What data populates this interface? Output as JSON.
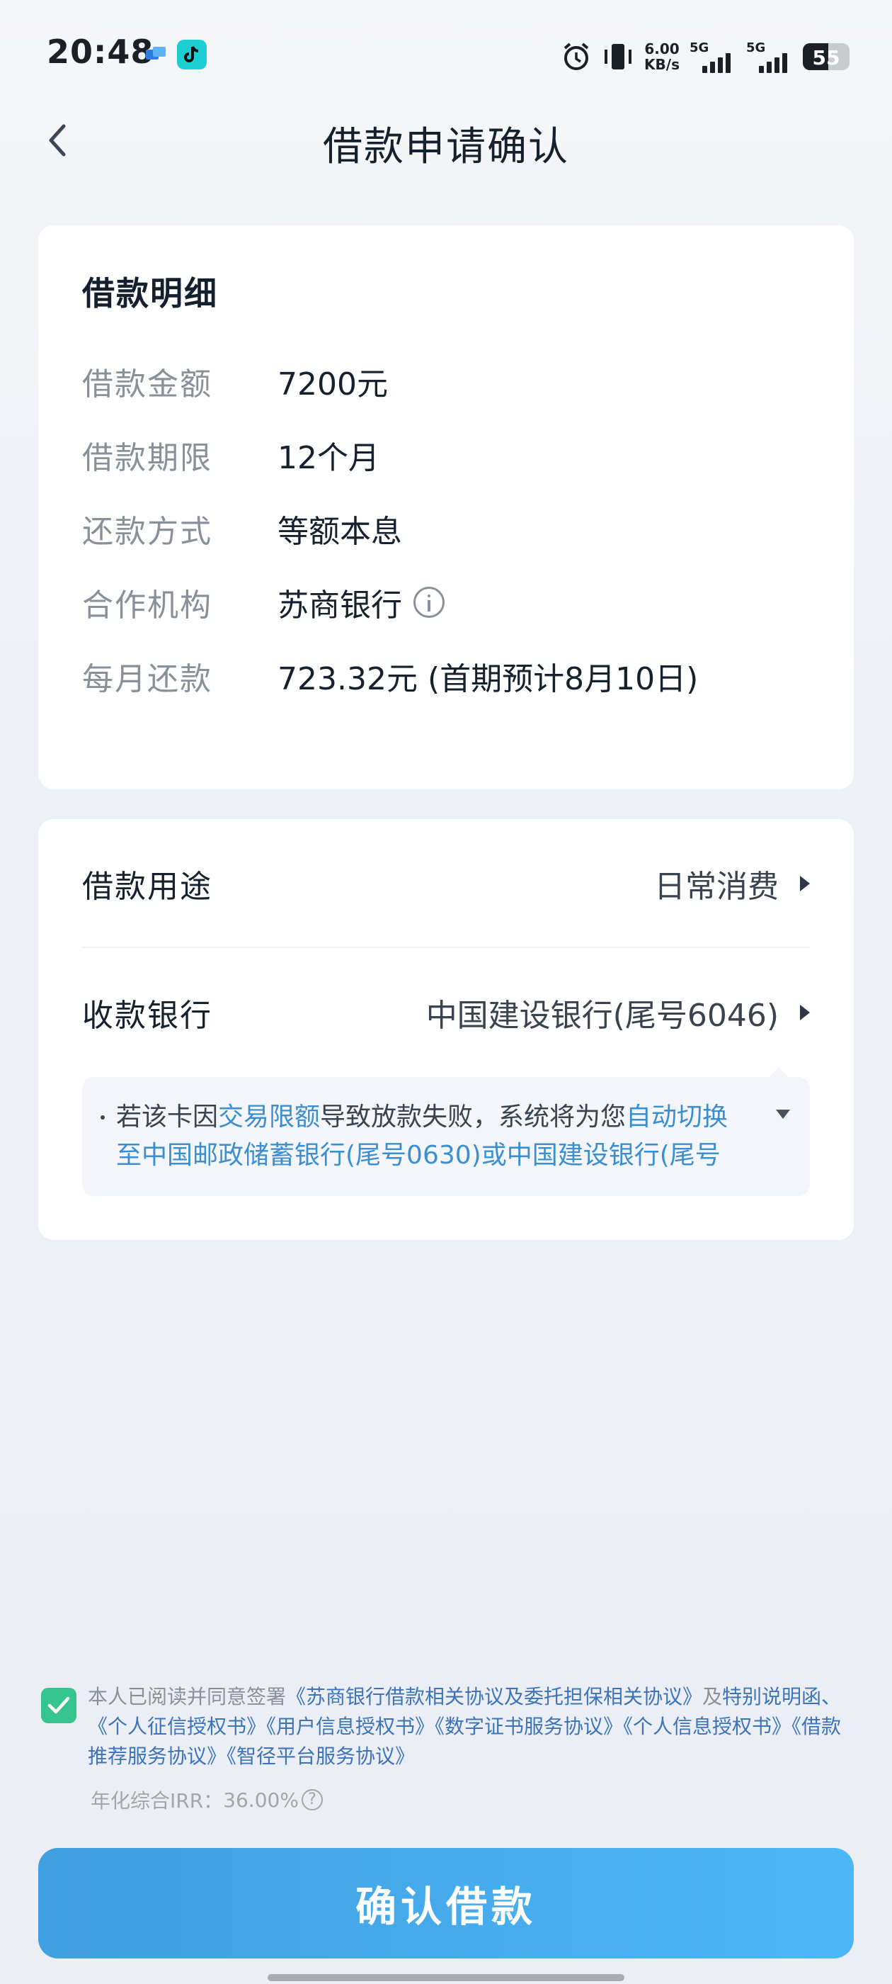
{
  "status_bar": {
    "time": "20:48",
    "speed_value": "6.00",
    "speed_unit": "KB/s",
    "network1": "5G",
    "network2": "5G",
    "battery": "55",
    "battery_level": 0.55
  },
  "header": {
    "title": "借款申请确认"
  },
  "loan_detail": {
    "title": "借款明细",
    "rows": [
      {
        "label": "借款金额",
        "value": "7200元"
      },
      {
        "label": "借款期限",
        "value": "12个月"
      },
      {
        "label": "还款方式",
        "value": "等额本息"
      },
      {
        "label": "合作机构",
        "value": "苏商银行"
      },
      {
        "label": "每月还款",
        "value": "723.32元 (首期预计8月10日)"
      }
    ]
  },
  "options": {
    "purpose_label": "借款用途",
    "purpose_value": "日常消费",
    "bank_label": "收款银行",
    "bank_value": "中国建设银行(尾号6046)"
  },
  "notice": {
    "part1": "若该卡因",
    "link1": "交易限额",
    "part2": "导致放款失败，系统将为您",
    "link2": "自动切换",
    "line2": "至中国邮政储蓄银行(尾号0630)或中国建设银行(尾号"
  },
  "agreement": {
    "prefix": "本人已阅读并同意签署",
    "link1": "《苏商银行借款相关协议及委托担保相关协议》",
    "mid": "及",
    "link2": "特别说明函、《个人征信授权书》《用户信息授权书》《数字证书服务协议》《个人信息授权书》《借款推荐服务协议》《智径平台服务协议》",
    "irr_label": "年化综合IRR：",
    "irr_value": "36.00%"
  },
  "confirm_button": "确认借款",
  "colors": {
    "accent": "#4cb7f8",
    "link": "#3b8fd0",
    "checkbox": "#36c48f"
  }
}
